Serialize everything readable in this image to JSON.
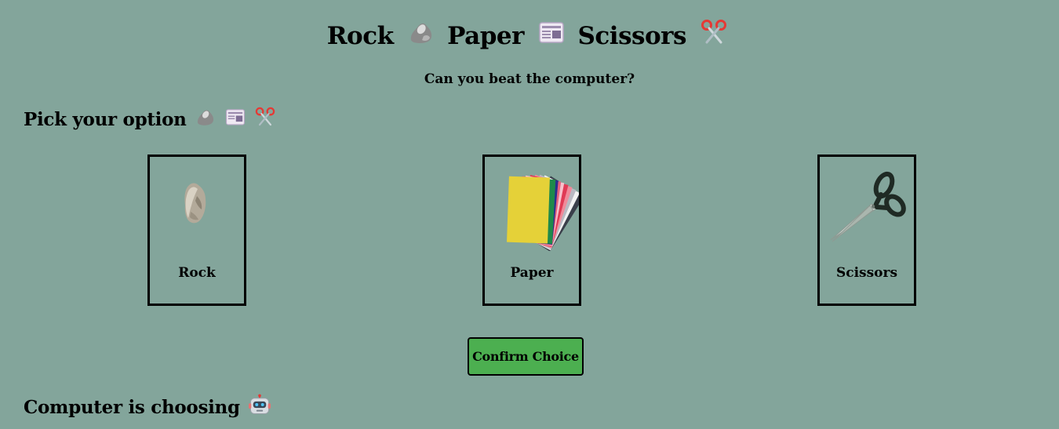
{
  "header": {
    "title_rock": "Rock",
    "title_paper": "Paper",
    "title_scissors": "Scissors",
    "subtitle": "Can you beat the computer?"
  },
  "pick_section": {
    "heading": "Pick your option"
  },
  "options": [
    {
      "label": "Rock",
      "icon": "rock-icon"
    },
    {
      "label": "Paper",
      "icon": "paper-stack-icon"
    },
    {
      "label": "Scissors",
      "icon": "scissors-icon"
    }
  ],
  "confirm_button": {
    "label": "Confirm Choice",
    "color": "#4caf50"
  },
  "computer_section": {
    "heading": "Computer is choosing",
    "icon": "robot-icon"
  },
  "colors": {
    "background": "#83a59b",
    "border": "#000000"
  }
}
